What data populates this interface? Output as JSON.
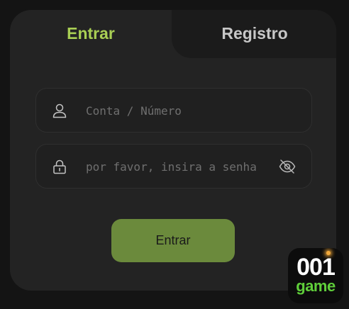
{
  "tabs": {
    "login_label": "Entrar",
    "register_label": "Registro",
    "active": "login"
  },
  "form": {
    "account_placeholder": "Conta / Número",
    "account_icon": "user-icon",
    "password_placeholder": "por favor, insira a senha",
    "password_icon": "lock-icon",
    "visibility_icon": "eye-off-icon",
    "submit_label": "Entrar"
  },
  "badge": {
    "number": "001",
    "word": "game"
  },
  "colors": {
    "accent": "#a9cf54",
    "button": "#6b8a3c",
    "badge_green": "#5fce3a",
    "card": "#232323",
    "background": "#141414"
  }
}
